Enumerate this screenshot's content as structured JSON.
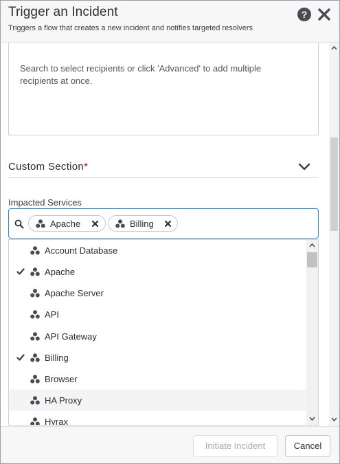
{
  "header": {
    "title": "Trigger an Incident",
    "subtitle": "Triggers a flow that creates a new incident and notifies targeted resolvers",
    "help_icon": "question-circle-icon",
    "close_icon": "close-icon",
    "help_label": "?"
  },
  "recipients": {
    "hint": "Search to select recipients or click 'Advanced' to add multiple recipients at once."
  },
  "custom_section": {
    "title": "Custom Section",
    "required_marker": "*",
    "chevron_icon": "chevron-down-icon"
  },
  "impacted_services": {
    "label": "Impacted Services",
    "search_icon": "search-icon",
    "chips": [
      {
        "label": "Apache",
        "icon": "service-icon",
        "remove_icon": "remove-x-icon"
      },
      {
        "label": "Billing",
        "icon": "service-icon",
        "remove_icon": "remove-x-icon"
      }
    ],
    "options": [
      {
        "label": "Account Database",
        "selected": false
      },
      {
        "label": "Apache",
        "selected": true
      },
      {
        "label": "Apache Server",
        "selected": false
      },
      {
        "label": "API",
        "selected": false
      },
      {
        "label": "API Gateway",
        "selected": false
      },
      {
        "label": "Billing",
        "selected": true
      },
      {
        "label": "Browser",
        "selected": false
      },
      {
        "label": "HA Proxy",
        "selected": false,
        "hovered": true
      },
      {
        "label": "Hyrax",
        "selected": false
      }
    ]
  },
  "footer": {
    "initiate_label": "Initiate Incident",
    "initiate_disabled": true,
    "cancel_label": "Cancel"
  },
  "colors": {
    "accent": "#1f8dd6",
    "required": "#d0021b",
    "icon_dark": "#4b4b55",
    "hover_row": "#f3f4f6"
  }
}
